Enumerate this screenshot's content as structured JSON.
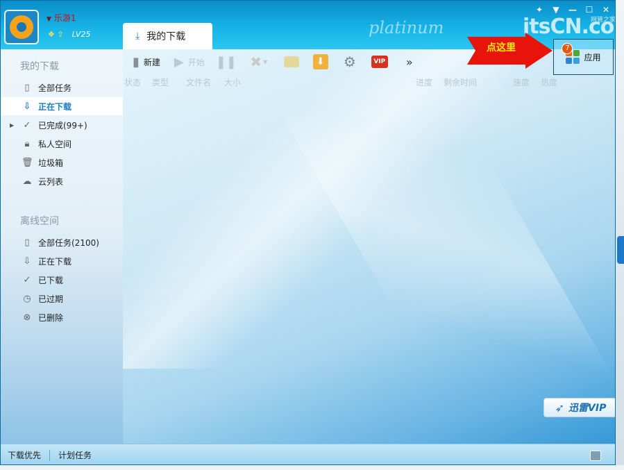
{
  "header": {
    "username": "乐游1",
    "level": "LV25",
    "watermark": "platinum",
    "site_logo": "itsCN.com",
    "site_logo_sub": "网管之家"
  },
  "window_controls": {
    "skin": "✦",
    "menu": "▼",
    "minimize": "—",
    "maximize": "☐",
    "close": "✕"
  },
  "tab": {
    "label": "我的下载"
  },
  "annotation": {
    "label": "点这里"
  },
  "apps": {
    "label": "应用",
    "badge": "7"
  },
  "toolbar": {
    "new_label": "新建",
    "start_label": "开始",
    "more_label": "»"
  },
  "columns": [
    "状态",
    "类型",
    "文件名",
    "大小",
    "进度",
    "剩余时间",
    "速度",
    "热度"
  ],
  "sidebar": {
    "my_downloads_title": "我的下载",
    "my_items": [
      {
        "label": "全部任务",
        "icon": "document-icon"
      },
      {
        "label": "正在下载",
        "icon": "download-arrow-icon",
        "active": true
      },
      {
        "label": "已完成(99+)",
        "icon": "check-icon"
      },
      {
        "label": "私人空间",
        "icon": "lock-icon"
      },
      {
        "label": "垃圾箱",
        "icon": "trash-icon"
      },
      {
        "label": "云列表",
        "icon": "cloud-icon"
      }
    ],
    "offline_title": "离线空间",
    "offline_items": [
      {
        "label": "全部任务(2100)",
        "icon": "document-icon"
      },
      {
        "label": "正在下载",
        "icon": "download-arrow-icon"
      },
      {
        "label": "已下载",
        "icon": "check-icon"
      },
      {
        "label": "已过期",
        "icon": "clock-icon"
      },
      {
        "label": "已删除",
        "icon": "delete-circle-icon"
      }
    ]
  },
  "vip": {
    "label": "迅雷VIP"
  },
  "statusbar": {
    "priority_label": "下载优先",
    "schedule_label": "计划任务"
  },
  "colors": {
    "accent": "#1a7ec4",
    "username": "#c31212",
    "annotation_arrow": "#e8140c",
    "annotation_text": "#fff200"
  }
}
